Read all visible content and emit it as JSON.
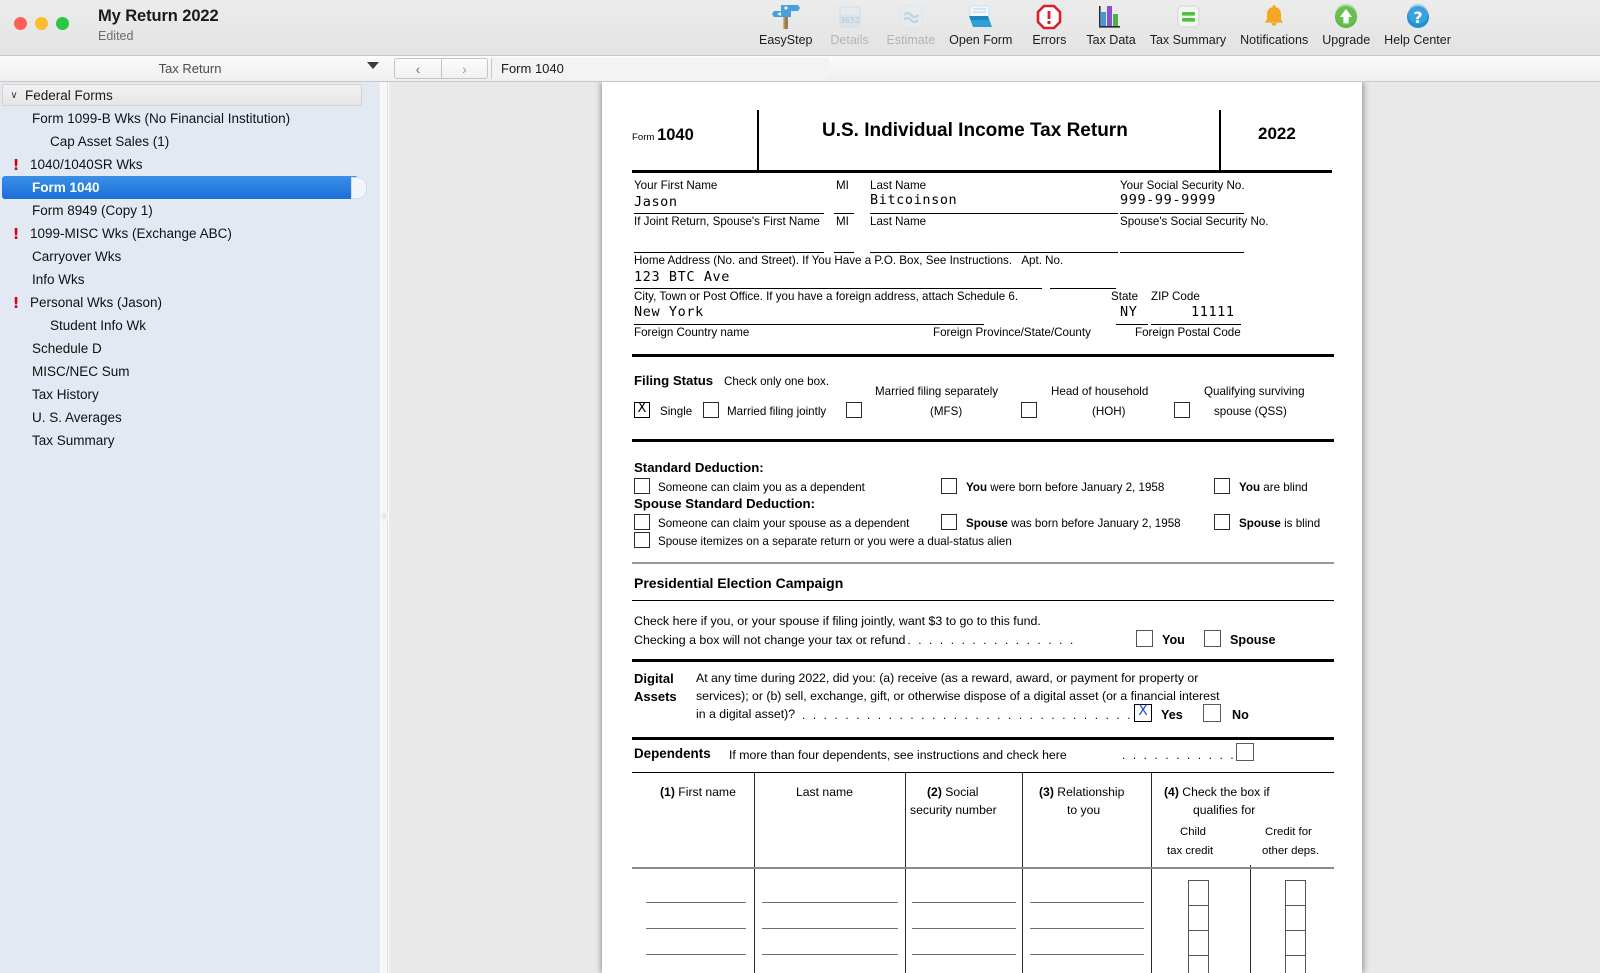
{
  "window": {
    "title": "My Return 2022",
    "subtitle": "Edited",
    "traffic_lights": [
      "close",
      "minimize",
      "zoom"
    ]
  },
  "toolbar": {
    "items": [
      {
        "label": "EasyStep",
        "icon": "signpost-icon",
        "disabled": false
      },
      {
        "label": "Details",
        "icon": "details-icon",
        "disabled": true
      },
      {
        "label": "Estimate",
        "icon": "estimate-icon",
        "disabled": true
      },
      {
        "label": "Open Form",
        "icon": "open-form-icon",
        "disabled": false
      },
      {
        "label": "Errors",
        "icon": "errors-icon",
        "disabled": false
      },
      {
        "label": "Tax Data",
        "icon": "tax-data-icon",
        "disabled": false
      },
      {
        "label": "Tax Summary",
        "icon": "tax-summary-icon",
        "disabled": false
      },
      {
        "label": "Notifications",
        "icon": "bell-icon",
        "disabled": false
      },
      {
        "label": "Upgrade",
        "icon": "upgrade-arrow-icon",
        "disabled": false
      },
      {
        "label": "Help Center",
        "icon": "help-question-icon",
        "disabled": false
      }
    ]
  },
  "nav": {
    "back_glyph": "‹",
    "forward_glyph": "›",
    "path": "Form 1040"
  },
  "sidebar": {
    "header": "Tax Return",
    "group": {
      "label": "Federal Forms",
      "disclosure": "∨"
    },
    "items": [
      {
        "label": "Form 1099-B Wks (No Financial Institution)",
        "indent": 1,
        "error": false,
        "selected": false
      },
      {
        "label": "Cap Asset Sales (1)",
        "indent": 2,
        "error": false,
        "selected": false
      },
      {
        "label": "1040/1040SR Wks",
        "indent": 1,
        "error": true,
        "selected": false
      },
      {
        "label": "Form 1040",
        "indent": 1,
        "error": false,
        "selected": true
      },
      {
        "label": "Form 8949 (Copy 1)",
        "indent": 1,
        "error": false,
        "selected": false
      },
      {
        "label": "1099-MISC Wks (Exchange ABC)",
        "indent": 1,
        "error": true,
        "selected": false
      },
      {
        "label": "Carryover Wks",
        "indent": 1,
        "error": false,
        "selected": false
      },
      {
        "label": "Info Wks",
        "indent": 1,
        "error": false,
        "selected": false
      },
      {
        "label": "Personal Wks (Jason)",
        "indent": 1,
        "error": true,
        "selected": false
      },
      {
        "label": "Student Info Wk",
        "indent": 2,
        "error": false,
        "selected": false
      },
      {
        "label": "Schedule D",
        "indent": 1,
        "error": false,
        "selected": false
      },
      {
        "label": "MISC/NEC Sum",
        "indent": 1,
        "error": false,
        "selected": false
      },
      {
        "label": "Tax History",
        "indent": 1,
        "error": false,
        "selected": false
      },
      {
        "label": "U. S. Averages",
        "indent": 1,
        "error": false,
        "selected": false
      },
      {
        "label": "Tax Summary",
        "indent": 1,
        "error": false,
        "selected": false
      }
    ]
  },
  "form": {
    "header": {
      "form_word": "Form",
      "form_number": "1040",
      "title": "U.S. Individual Income Tax Return",
      "year": "2022"
    },
    "name_block": {
      "first_name_label": "Your First Name",
      "first_name_value": "Jason",
      "mi_label": "MI",
      "mi_value": "",
      "last_name_label": "Last Name",
      "last_name_value": "Bitcoinson",
      "ssn_label": "Your Social Security No.",
      "ssn_value": "999-99-9999",
      "spouse_first_label": "If Joint Return, Spouse's First Name",
      "spouse_mi_label": "MI",
      "spouse_last_label": "Last Name",
      "spouse_ssn_label": "Spouse's Social Security No.",
      "address_label": "Home Address (No. and Street). If You Have a P.O. Box, See Instructions.",
      "apt_label": "Apt.  No.",
      "address_value": "123 BTC Ave",
      "city_label": "City, Town or Post Office. If you have a foreign address, attach Schedule 6.",
      "state_label": "State",
      "zip_label": "ZIP Code",
      "city_value": "New York",
      "state_value": "NY",
      "zip_value": "11111",
      "foreign_country_label": "Foreign Country name",
      "foreign_province_label": "Foreign Province/State/County",
      "foreign_postal_label": "Foreign Postal Code"
    },
    "filing_status": {
      "heading": "Filing Status",
      "instruction": "Check only one box.",
      "options": [
        {
          "label": "Single",
          "checked": true,
          "mark": "X",
          "sub": ""
        },
        {
          "label": "Married filing jointly",
          "checked": false,
          "mark": "",
          "sub": ""
        },
        {
          "label": "Married filing separately",
          "checked": false,
          "mark": "",
          "sub": "(MFS)"
        },
        {
          "label": "Head of household",
          "checked": false,
          "mark": "",
          "sub": "(HOH)"
        },
        {
          "label": "Qualifying surviving",
          "checked": false,
          "mark": "",
          "sub": "spouse (QSS)"
        }
      ]
    },
    "standard_deduction": {
      "heading": "Standard Deduction:",
      "spouse_heading": "Spouse Standard Deduction:",
      "row1": [
        {
          "text": "Someone can claim you as a dependent",
          "bold_prefix": "",
          "checked": false
        },
        {
          "text": " were born before January 2, 1958",
          "bold_prefix": "You",
          "checked": false
        },
        {
          "text": " are blind",
          "bold_prefix": "You",
          "checked": false
        }
      ],
      "row2": [
        {
          "text": "Someone can claim your spouse as a dependent",
          "bold_prefix": "",
          "checked": false
        },
        {
          "text": " was born before January 2, 1958",
          "bold_prefix": "Spouse",
          "checked": false
        },
        {
          "text": " is blind",
          "bold_prefix": "Spouse",
          "checked": false
        }
      ],
      "row3": {
        "text": "Spouse itemizes on a separate return or you were a dual-status alien",
        "checked": false
      }
    },
    "presidential": {
      "heading": "Presidential Election Campaign",
      "line1": "Check here if you, or your spouse if filing jointly, want $3 to go to this fund.",
      "line2": "Checking a box will not change your tax or refund",
      "dots": ". . . . . . . . . . . . . . . . . . . .",
      "you_label": "You",
      "spouse_label": "Spouse",
      "you_checked": false,
      "spouse_checked": false
    },
    "digital_assets": {
      "label_line1": "Digital",
      "label_line2": "Assets",
      "q_line1": "At any time during 2022, did you: (a) receive (as a reward, award, or payment for property or",
      "q_line2": "services); or (b) sell, exchange, gift, or otherwise dispose of a digital asset (or a financial interest",
      "q_line3": "in a digital asset)?",
      "dots": ". . . . . . . . . . . . . . . . . . . . . . . . . . . . . . . .",
      "yes_label": "Yes",
      "no_label": "No",
      "yes_checked": true,
      "yes_mark": "X",
      "no_checked": false
    },
    "dependents": {
      "heading": "Dependents",
      "instruction": "If more than four dependents, see instructions and check here",
      "dots": ". . . . . . . . . . .",
      "more_checked": false,
      "columns": [
        {
          "num": "(1)",
          "name": " First name",
          "line2": ""
        },
        {
          "num": "",
          "name": "Last name",
          "line2": ""
        },
        {
          "num": "(2)",
          "name": " Social",
          "line2": "security number"
        },
        {
          "num": "(3)",
          "name": " Relationship",
          "line2": "to you"
        },
        {
          "num": "(4)",
          "name": " Check the box if",
          "line2": "qualifies for"
        }
      ],
      "sub_columns": [
        {
          "line1": "Child",
          "line2": "tax credit"
        },
        {
          "line1": "Credit for",
          "line2": "other deps."
        }
      ],
      "rows": 4
    }
  },
  "colors": {
    "selection_blue": "#1b6fd6",
    "error_red": "#d0021b",
    "digital_x_blue": "#1c4fd8",
    "sidebar_bg": "#e2e9f3",
    "canvas_bg": "#e9e9e9"
  }
}
